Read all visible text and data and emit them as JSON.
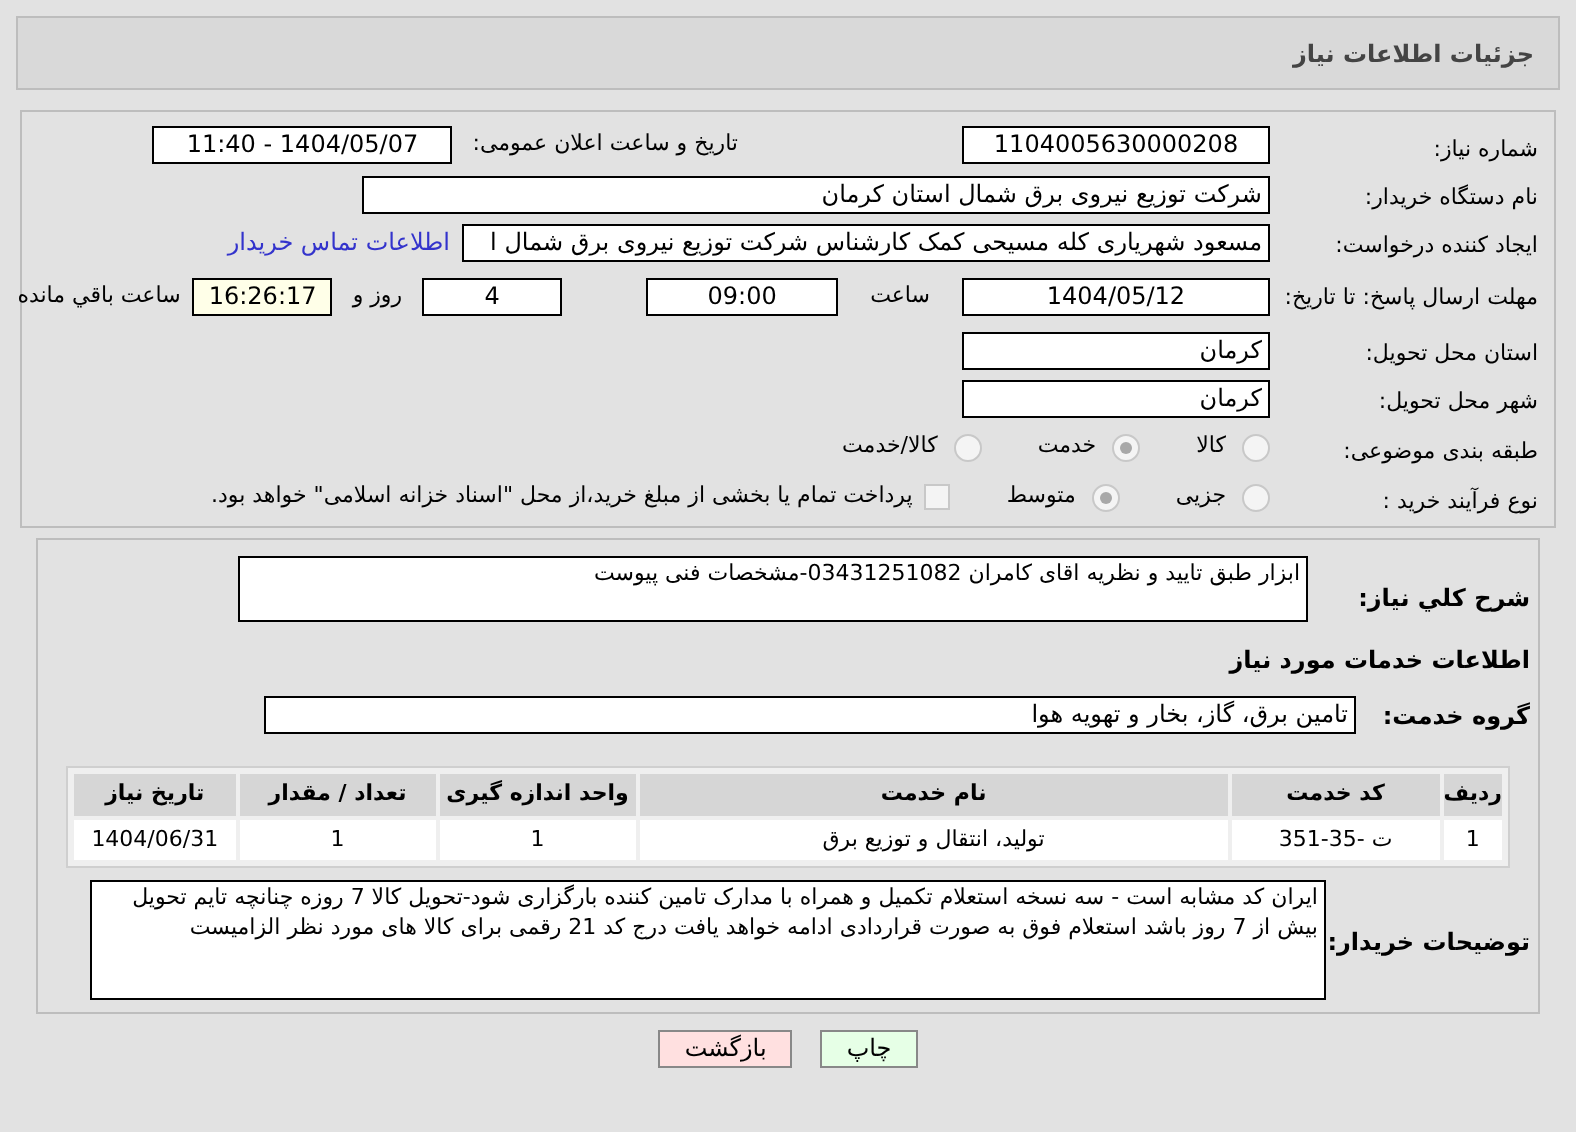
{
  "header": {
    "title": "جزئیات اطلاعات نیاز"
  },
  "details": {
    "need_number": {
      "label": "شماره نیاز:",
      "value": "1104005630000208"
    },
    "announce": {
      "label": "تاریخ و ساعت اعلان عمومی:",
      "value": "1404/05/07 - 11:40"
    },
    "buyer": {
      "label": "نام دستگاه خریدار:",
      "value": "شرکت توزیع نیروی برق شمال استان کرمان"
    },
    "creator": {
      "label": "ایجاد کننده درخواست:",
      "value": "مسعود شهریاری کله مسیحی کمک کارشناس شرکت توزیع نیروی برق شمال ا",
      "link": "اطلاعات تماس خریدار"
    },
    "deadline": {
      "label": "مهلت ارسال پاسخ: تا تاریخ:",
      "date": "1404/05/12",
      "time_label": "ساعت",
      "time": "09:00",
      "days": "4",
      "days_label": "روز و",
      "remaining": "16:26:17",
      "remaining_label": "ساعت باقي مانده"
    },
    "province": {
      "label": "استان محل تحویل:",
      "value": "کرمان"
    },
    "city": {
      "label": "شهر محل تحویل:",
      "value": "کرمان"
    },
    "category": {
      "label": "طبقه بندی موضوعی:",
      "options": [
        {
          "label": "کالا",
          "selected": false
        },
        {
          "label": "خدمت",
          "selected": true
        },
        {
          "label": "کالا/خدمت",
          "selected": false
        }
      ]
    },
    "purchase_type": {
      "label": "نوع فرآیند خرید :",
      "options": [
        {
          "label": "جزیی",
          "selected": false
        },
        {
          "label": "متوسط",
          "selected": true
        }
      ],
      "payment": {
        "checked": false,
        "text": "پرداخت تمام یا بخشی از مبلغ خرید،از محل \"اسناد خزانه اسلامی\" خواهد بود."
      }
    }
  },
  "description": {
    "label": "شرح کلي نیاز:",
    "value": "ابزار طبق تایید و نظریه اقای کامران 03431251082-مشخصات فنی پیوست"
  },
  "services_heading": "اطلاعات خدمات مورد نیاز",
  "service_group": {
    "label": "گروه خدمت:",
    "value": "تامین برق، گاز، بخار و تهویه هوا"
  },
  "table": {
    "columns": [
      "ردیف",
      "کد خدمت",
      "نام خدمت",
      "واحد اندازه گیری",
      "تعداد / مقدار",
      "تاریخ نیاز"
    ],
    "rows": [
      [
        "1",
        "ت -35-351",
        "تولید، انتقال و توزیع برق",
        "1",
        "1",
        "1404/06/31"
      ]
    ]
  },
  "buyer_notes": {
    "label": "توضیحات خریدار:",
    "value": "ایران کد مشابه است - سه نسخه استعلام تکمیل و همراه با مدارک تامین کننده بارگزاری شود-تحویل کالا 7 روزه چنانچه تایم تحویل بیش از 7 روز باشد استعلام فوق به صورت قراردادی ادامه خواهد یافت  درج کد 21 رقمی برای کالا های مورد نظر الزامیست"
  },
  "buttons": [
    {
      "label": "چاپ",
      "kind": "print"
    },
    {
      "label": "بازگشت",
      "kind": "back"
    }
  ]
}
